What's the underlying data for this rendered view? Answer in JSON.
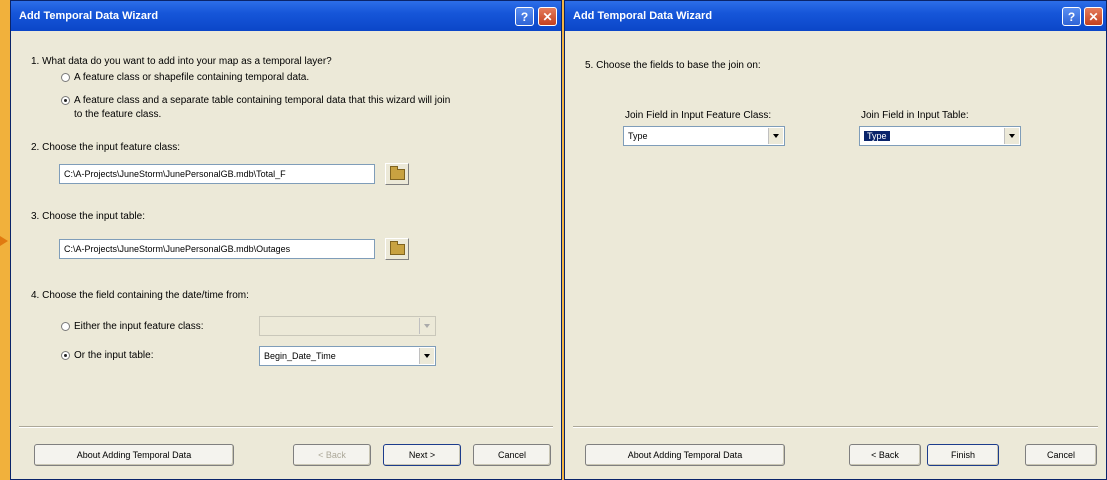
{
  "wizard1": {
    "title": "Add Temporal Data Wizard",
    "help_glyph": "?",
    "close_glyph": "✕",
    "q1": {
      "text": "1.  What data do you want to add into your map as a temporal layer?",
      "option_a": "A feature class or shapefile containing temporal data.",
      "option_b_line1": "A feature class and a separate table containing temporal data that this wizard will join",
      "option_b_line2": "to the feature class.",
      "selected": "option_b"
    },
    "q2": {
      "text": "2.  Choose the input feature class:",
      "value": "C:\\A-Projects\\JuneStorm\\JunePersonalGB.mdb\\Total_F"
    },
    "q3": {
      "text": "3.  Choose the input table:",
      "value": "C:\\A-Projects\\JuneStorm\\JunePersonalGB.mdb\\Outages"
    },
    "q4": {
      "text": "4.  Choose the field containing the date/time from:",
      "option_a": "Either the input feature class:",
      "option_a_value": "",
      "option_b": "Or the input table:",
      "option_b_value": "Begin_Date_Time",
      "selected": "option_b"
    },
    "buttons": {
      "about": "About Adding Temporal Data",
      "back": "< Back",
      "next": "Next >",
      "cancel": "Cancel"
    }
  },
  "wizard2": {
    "title": "Add Temporal Data Wizard",
    "help_glyph": "?",
    "close_glyph": "✕",
    "q5": {
      "text": "5.  Choose the fields to base the join on:",
      "feature_label": "Join Field in Input Feature Class:",
      "feature_value": "Type",
      "table_label": "Join Field in Input Table:",
      "table_value": "Type"
    },
    "buttons": {
      "about": "About Adding Temporal Data",
      "back": "< Back",
      "finish": "Finish",
      "cancel": "Cancel"
    }
  },
  "colors": {
    "titlebar": "#0b46c8",
    "dialog_bg": "#ece9d8",
    "desktop": "#f2b544",
    "selection": "#0a246a"
  }
}
